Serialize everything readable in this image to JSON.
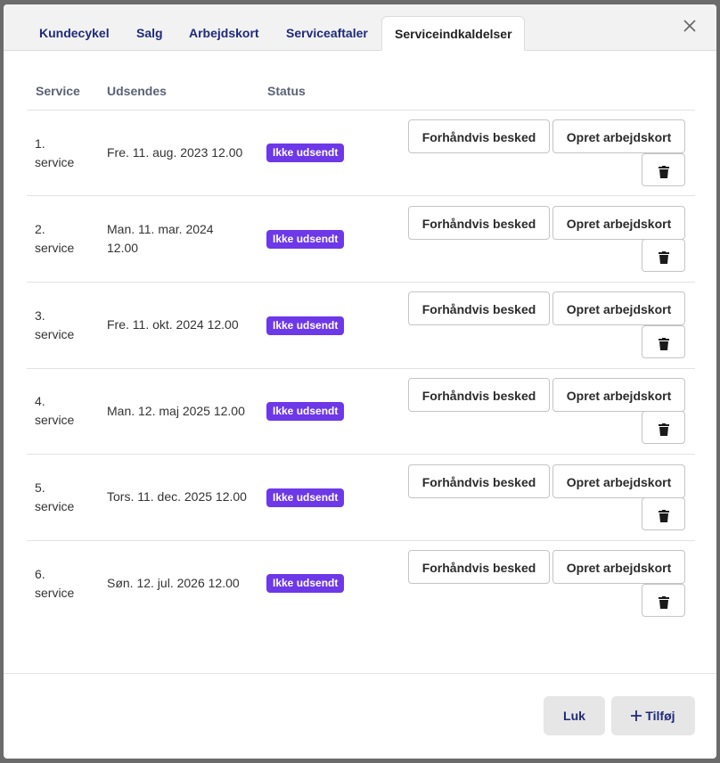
{
  "tabs": [
    {
      "label": "Kundecykel"
    },
    {
      "label": "Salg"
    },
    {
      "label": "Arbejdskort"
    },
    {
      "label": "Serviceaftaler"
    },
    {
      "label": "Serviceindkaldelser"
    }
  ],
  "active_tab": "Serviceindkaldelser",
  "icons": {
    "close": "close-icon",
    "delete": "trash-icon",
    "add": "plus-icon"
  },
  "colors": {
    "status_badge": "#6d38e8",
    "tab_text": "#1f2a7a"
  },
  "table": {
    "headers": {
      "service": "Service",
      "sent": "Udsendes",
      "status": "Status"
    },
    "rows": [
      {
        "service_line1": "1.",
        "service_line2": "service",
        "sent_line1": "Fre. 11. aug. 2023 12.00",
        "sent_line2": "",
        "status": "Ikke udsendt"
      },
      {
        "service_line1": "2.",
        "service_line2": "service",
        "sent_line1": "Man. 11. mar. 2024",
        "sent_line2": "12.00",
        "status": "Ikke udsendt"
      },
      {
        "service_line1": "3.",
        "service_line2": "service",
        "sent_line1": "Fre. 11. okt. 2024 12.00",
        "sent_line2": "",
        "status": "Ikke udsendt"
      },
      {
        "service_line1": "4.",
        "service_line2": "service",
        "sent_line1": "Man. 12. maj 2025 12.00",
        "sent_line2": "",
        "status": "Ikke udsendt"
      },
      {
        "service_line1": "5.",
        "service_line2": "service",
        "sent_line1": "Tors. 11. dec. 2025 12.00",
        "sent_line2": "",
        "status": "Ikke udsendt"
      },
      {
        "service_line1": "6.",
        "service_line2": "service",
        "sent_line1": "Søn. 12. jul. 2026 12.00",
        "sent_line2": "",
        "status": "Ikke udsendt"
      }
    ]
  },
  "row_actions": {
    "preview": "Forhåndvis besked",
    "create": "Opret arbejdskort"
  },
  "footer": {
    "close_label": "Luk",
    "add_label": "Tilføj"
  }
}
